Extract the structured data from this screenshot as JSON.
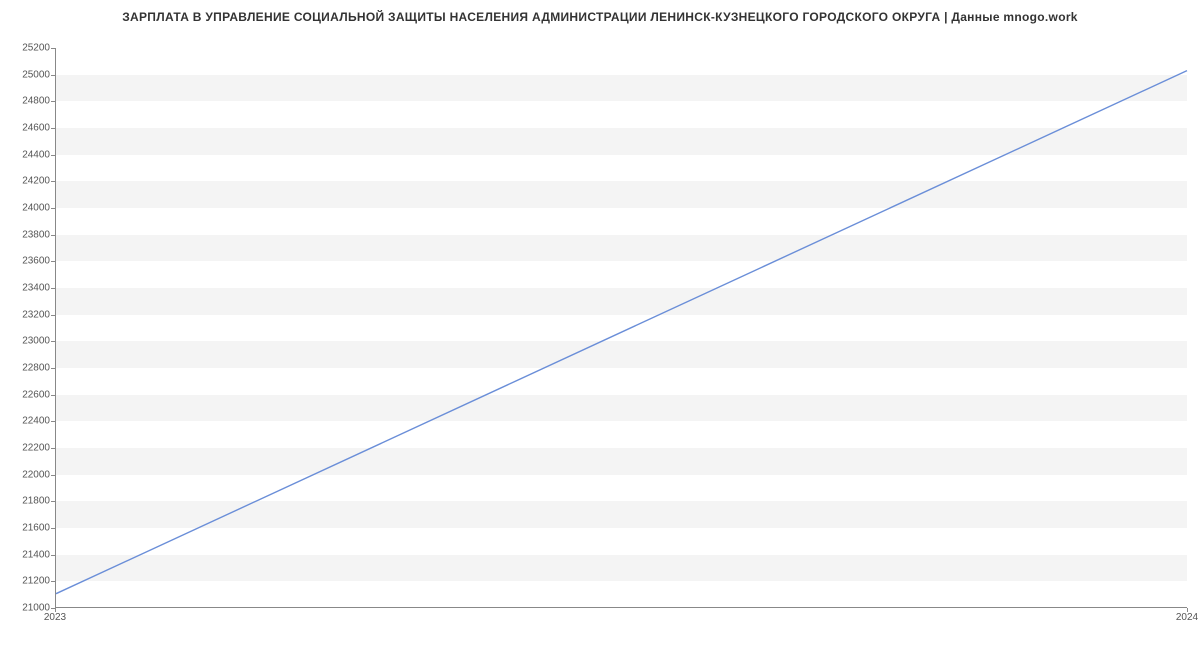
{
  "chart_data": {
    "type": "line",
    "title": "ЗАРПЛАТА В УПРАВЛЕНИЕ СОЦИАЛЬНОЙ ЗАЩИТЫ НАСЕЛЕНИЯ АДМИНИСТРАЦИИ ЛЕНИНСК-КУЗНЕЦКОГО ГОРОДСКОГО ОКРУГА | Данные mnogo.work",
    "x": [
      2023,
      2024
    ],
    "values": [
      21100,
      25030
    ],
    "xlabel": "",
    "ylabel": "",
    "xlim": [
      2023,
      2024
    ],
    "ylim": [
      21000,
      25200
    ],
    "y_ticks": [
      21000,
      21200,
      21400,
      21600,
      21800,
      22000,
      22200,
      22400,
      22600,
      22800,
      23000,
      23200,
      23400,
      23600,
      23800,
      24000,
      24200,
      24400,
      24600,
      24800,
      25000,
      25200
    ],
    "x_ticks": [
      2023,
      2024
    ],
    "grid": true,
    "line_color": "#6a8ed8"
  }
}
